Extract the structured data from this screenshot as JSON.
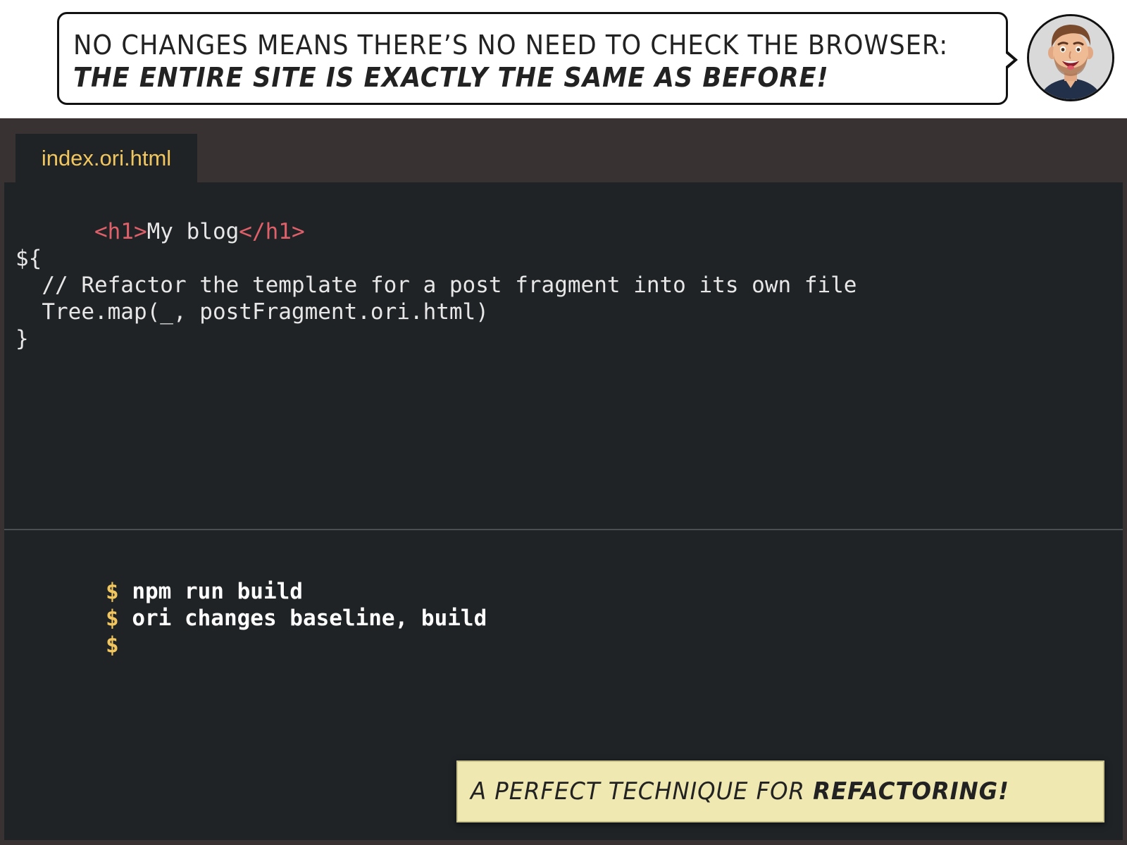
{
  "speech_bubble": {
    "line1": "No changes means there’s no need to check the browser:",
    "line2": "The entire site is exactly the same as before!"
  },
  "avatar": {
    "icon": "smiling-man-avatar-icon"
  },
  "editor": {
    "tab_label": "index.ori.html",
    "code": {
      "line1": {
        "open_tag": "<h1>",
        "text": "My blog",
        "close_tag": "</h1>"
      },
      "line3": "${",
      "line4": "  // Refactor the template for a post fragment into its own file",
      "line5": "  Tree.map(_, postFragment.ori.html)",
      "line6": "}"
    }
  },
  "terminal": {
    "lines": [
      {
        "prompt": "$",
        "command": "npm run build"
      },
      {
        "prompt": "$",
        "command": "ori changes baseline, build"
      },
      {
        "prompt": "$",
        "command": ""
      }
    ]
  },
  "caption": {
    "text_prefix": "A perfect technique for ",
    "text_emphasis": "refactoring!"
  },
  "colors": {
    "tab_text": "#f2c65e",
    "tag": "#e0606a",
    "prompt": "#f2c65e",
    "editor_bg": "#1f2326",
    "window_bg": "#383232",
    "caption_bg": "#efe8b0"
  }
}
